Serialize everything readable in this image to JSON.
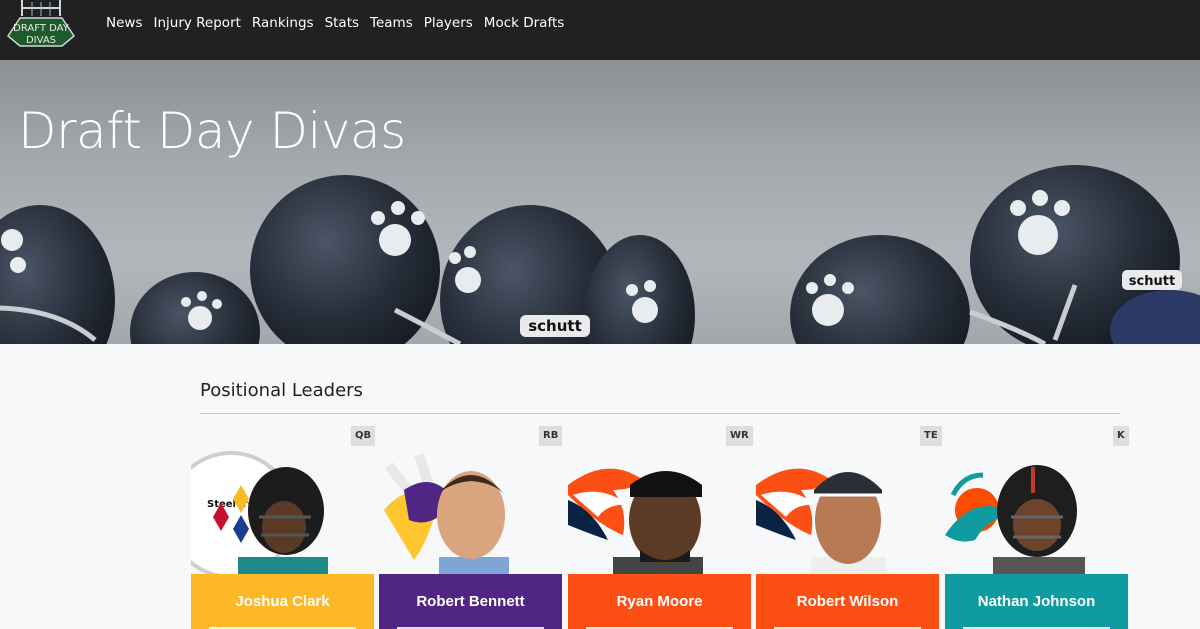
{
  "nav": {
    "logo_text": [
      "DRAFT DAY",
      "DIVAS"
    ],
    "links": [
      "News",
      "Injury Report",
      "Rankings",
      "Stats",
      "Teams",
      "Players",
      "Mock Drafts"
    ]
  },
  "hero": {
    "title": "Draft Day Divas",
    "helmet_brand": "schutt"
  },
  "section": {
    "title": "Positional Leaders"
  },
  "leaders": [
    {
      "position": "QB",
      "name": "Joshua Clark",
      "color": "#FDB827",
      "team_logo": "steelers-logo",
      "logo_text": "Steelers"
    },
    {
      "position": "RB",
      "name": "Robert Bennett",
      "color": "#4F2683",
      "team_logo": "vikings-logo"
    },
    {
      "position": "WR",
      "name": "Ryan Moore",
      "color": "#FB4F14",
      "team_logo": "broncos-logo"
    },
    {
      "position": "TE",
      "name": "Robert Wilson",
      "color": "#FB4F14",
      "team_logo": "broncos-logo"
    },
    {
      "position": "K",
      "name": "Nathan Johnson",
      "color": "#0F9BA0",
      "team_logo": "dolphins-logo"
    }
  ]
}
